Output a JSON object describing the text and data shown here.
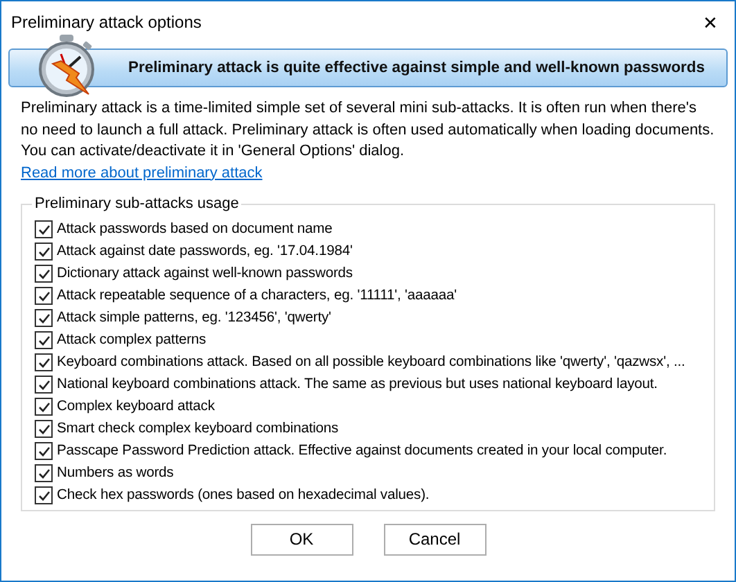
{
  "window": {
    "title": "Preliminary attack options",
    "close": "✕"
  },
  "banner": {
    "text": "Preliminary attack is quite effective against simple and well-known passwords"
  },
  "description": "Preliminary attack is a time-limited simple set of several mini sub-attacks. It is often run when there's no need to launch a full attack. Preliminary attack is often used automatically when loading documents. You can activate/deactivate it in 'General Options' dialog.",
  "link": "Read more about preliminary attack",
  "group": {
    "title": "Preliminary sub-attacks usage",
    "items": [
      {
        "label": "Attack passwords based on document name",
        "checked": true
      },
      {
        "label": "Attack against date passwords, eg. '17.04.1984'",
        "checked": true
      },
      {
        "label": "Dictionary attack against well-known passwords",
        "checked": true
      },
      {
        "label": "Attack repeatable sequence of a characters, eg. '11111', 'aaaaaa'",
        "checked": true
      },
      {
        "label": "Attack simple patterns, eg. '123456', 'qwerty'",
        "checked": true
      },
      {
        "label": "Attack complex patterns",
        "checked": true
      },
      {
        "label": "Keyboard combinations attack. Based on all possible keyboard combinations like 'qwerty', 'qazwsx', ...",
        "checked": true
      },
      {
        "label": "National keyboard combinations attack. The same as previous but uses national keyboard layout.",
        "checked": true
      },
      {
        "label": "Complex keyboard attack",
        "checked": true
      },
      {
        "label": "Smart check complex keyboard combinations",
        "checked": true
      },
      {
        "label": "Passcape Password Prediction attack. Effective against documents created in your local computer.",
        "checked": true
      },
      {
        "label": "Numbers as words",
        "checked": true
      },
      {
        "label": "Check hex passwords (ones based on hexadecimal values).",
        "checked": true
      }
    ]
  },
  "buttons": [
    "OK",
    "Cancel"
  ]
}
